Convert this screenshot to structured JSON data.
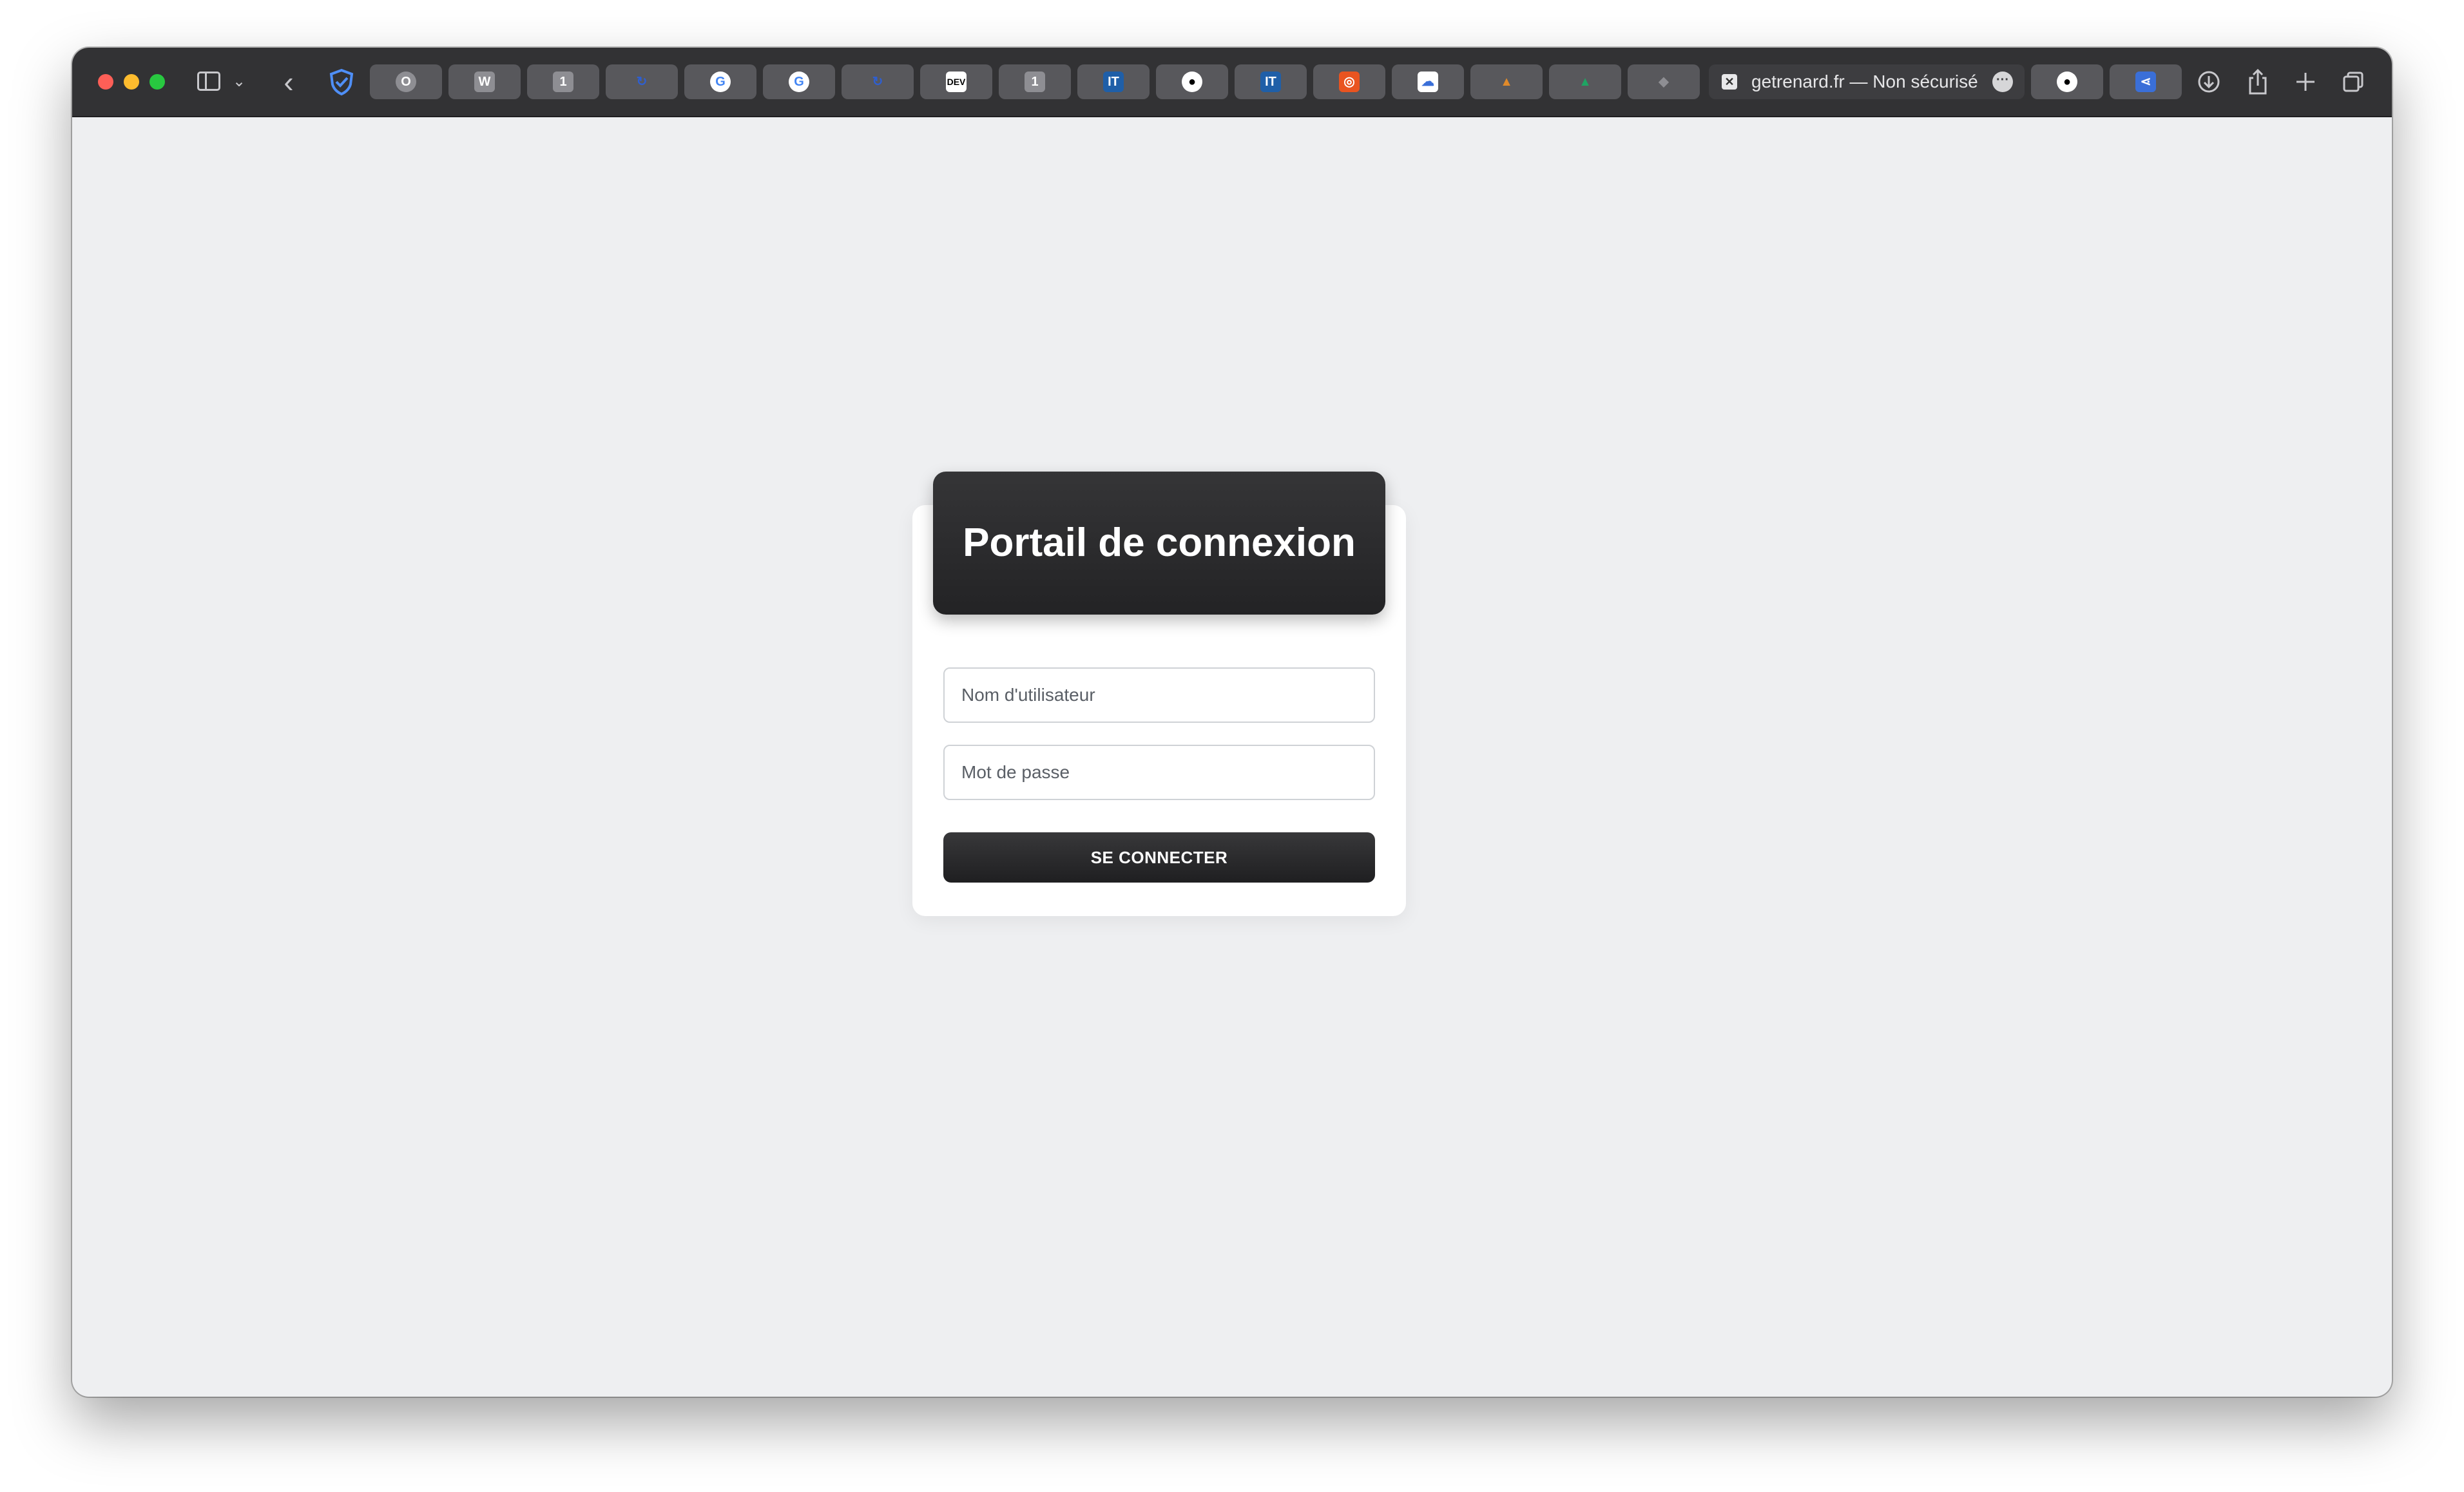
{
  "browser": {
    "tabs": [
      {
        "name": "tab-o",
        "glyph": "O",
        "color": "#8e8e93"
      },
      {
        "name": "tab-w",
        "glyph": "W",
        "color": "#8e8e93"
      },
      {
        "name": "tab-1password-a",
        "glyph": "1",
        "color": "#8e8e93"
      },
      {
        "name": "tab-sync-a",
        "glyph": "↻",
        "color": "#2f5fd0"
      },
      {
        "name": "tab-google-a",
        "glyph": "G",
        "color": "#ffffff"
      },
      {
        "name": "tab-google-b",
        "glyph": "G",
        "color": "#ffffff"
      },
      {
        "name": "tab-sync-b",
        "glyph": "↻",
        "color": "#2f5fd0"
      },
      {
        "name": "tab-dev",
        "glyph": "DEV",
        "color": "#000000"
      },
      {
        "name": "tab-1password-b",
        "glyph": "1",
        "color": "#8e8e93"
      },
      {
        "name": "tab-it-a",
        "glyph": "IT",
        "color": "#1f5fa8"
      },
      {
        "name": "tab-github-a",
        "glyph": "●",
        "color": "#ffffff"
      },
      {
        "name": "tab-it-b",
        "glyph": "IT",
        "color": "#1f5fa8"
      },
      {
        "name": "tab-ubuntu",
        "glyph": "◎",
        "color": "#e95420"
      },
      {
        "name": "tab-cloud",
        "glyph": "☁",
        "color": "#3a6fd8"
      },
      {
        "name": "tab-cone",
        "glyph": "▲",
        "color": "#e08a2a"
      },
      {
        "name": "tab-drive",
        "glyph": "▲",
        "color": "#1fa463"
      },
      {
        "name": "tab-drop",
        "glyph": "◆",
        "color": "#8e8e93"
      }
    ],
    "active_tab": {
      "favicon": "✕",
      "url": "getrenard.fr — Non sécurisé",
      "more": "···"
    },
    "pinned_after": [
      {
        "name": "tab-github-b",
        "glyph": "●",
        "color": "#ffffff"
      },
      {
        "name": "tab-share",
        "glyph": "⋖",
        "color": "#3a6fd8"
      }
    ]
  },
  "login": {
    "title": "Portail de connexion",
    "username_placeholder": "Nom d'utilisateur",
    "password_placeholder": "Mot de passe",
    "submit_label": "SE CONNECTER"
  }
}
